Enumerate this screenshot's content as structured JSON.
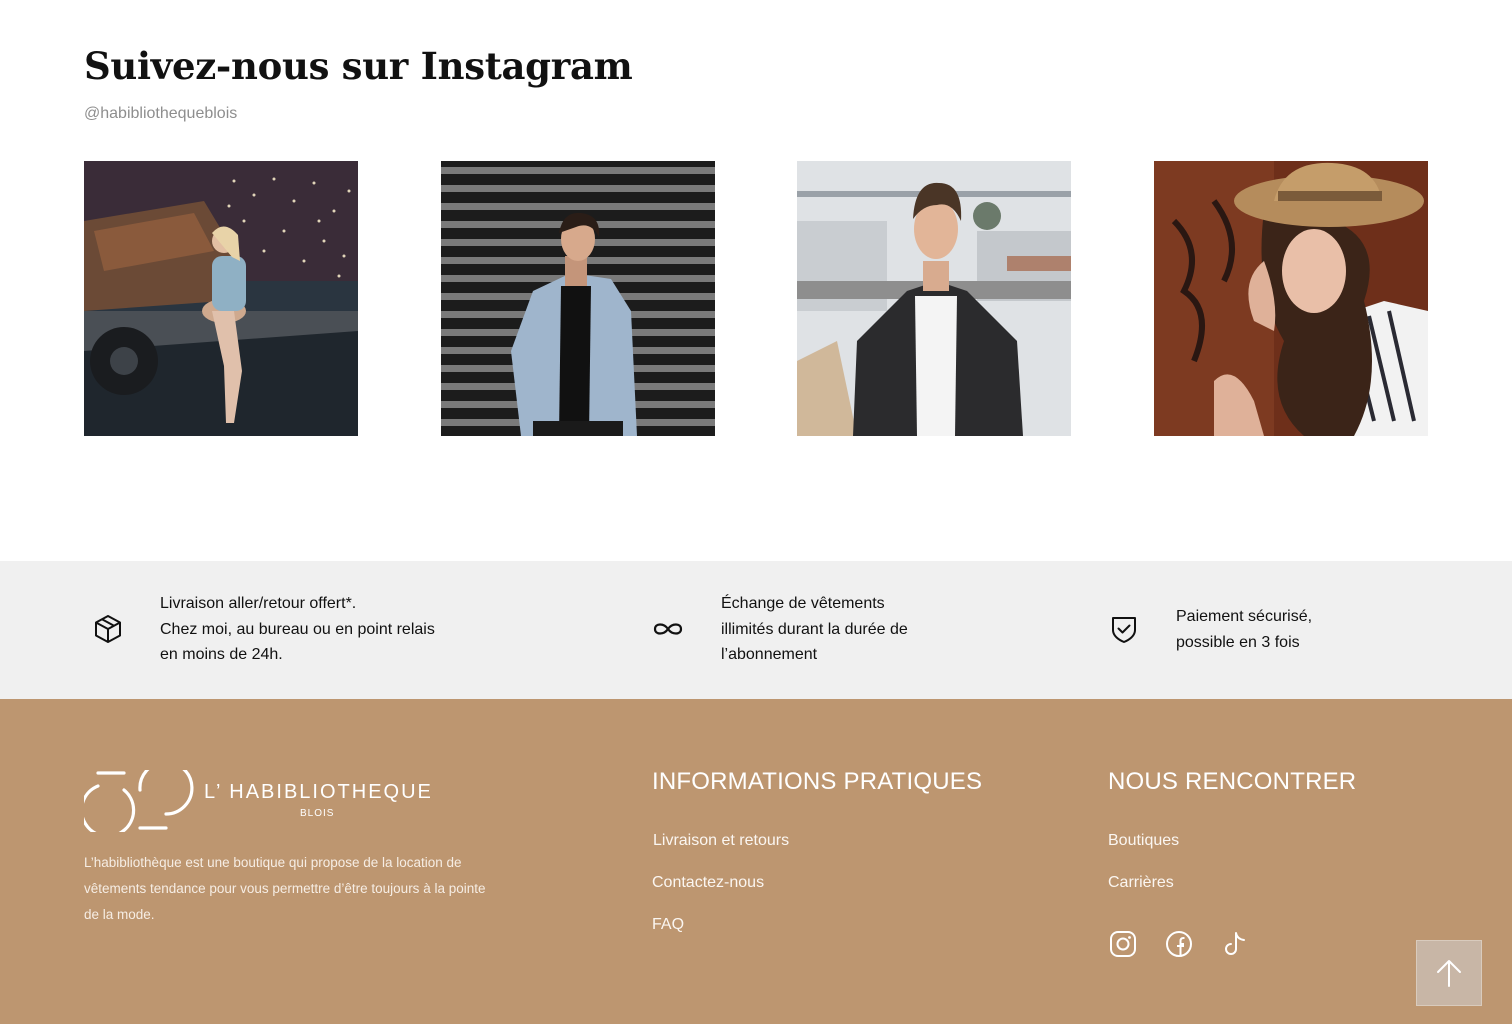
{
  "instagram": {
    "title": "Suivez-nous sur Instagram",
    "handle": "@habibliothequeblois",
    "posts": [
      {
        "icon": "photo-woman-vintage-truck"
      },
      {
        "icon": "photo-man-denim-jacket"
      },
      {
        "icon": "photo-man-black-puffer-jacket"
      },
      {
        "icon": "photo-woman-straw-hat"
      }
    ]
  },
  "features": [
    {
      "icon": "package-box-icon",
      "lines": [
        "Livraison aller/retour offert*.",
        "Chez moi, au bureau ou en point relais",
        "en moins de 24h."
      ]
    },
    {
      "icon": "infinity-icon",
      "lines": [
        "Échange de vêtements",
        "illimités durant la durée de",
        "l’abonnement"
      ]
    },
    {
      "icon": "shield-check-icon",
      "lines": [
        "Paiement sécurisé,",
        "possible en 3 fois"
      ]
    }
  ],
  "footer": {
    "logo_name": "L’ HABIBLIOTHEQUE",
    "logo_city": "BLOIS",
    "description_lines": [
      "L’habibliothèque est une boutique qui propose de la location de",
      "vêtements tendance pour vous permettre d’être toujours à la pointe",
      "de la mode."
    ],
    "info_title": "INFORMATIONS PRATIQUES",
    "info_links": [
      "Livraison et retours",
      "Contactez-nous",
      "FAQ"
    ],
    "meet_title": "NOUS RENCONTRER",
    "meet_links": [
      "Boutiques",
      "Carrières"
    ],
    "socials": [
      "instagram-icon",
      "facebook-icon",
      "tiktok-icon"
    ],
    "back_to_top_icon": "arrow-up-icon"
  },
  "colors": {
    "footer_bg": "#bd9670",
    "features_bg": "#f0f0f0",
    "back_to_top_bg": "#c8b6a6"
  }
}
